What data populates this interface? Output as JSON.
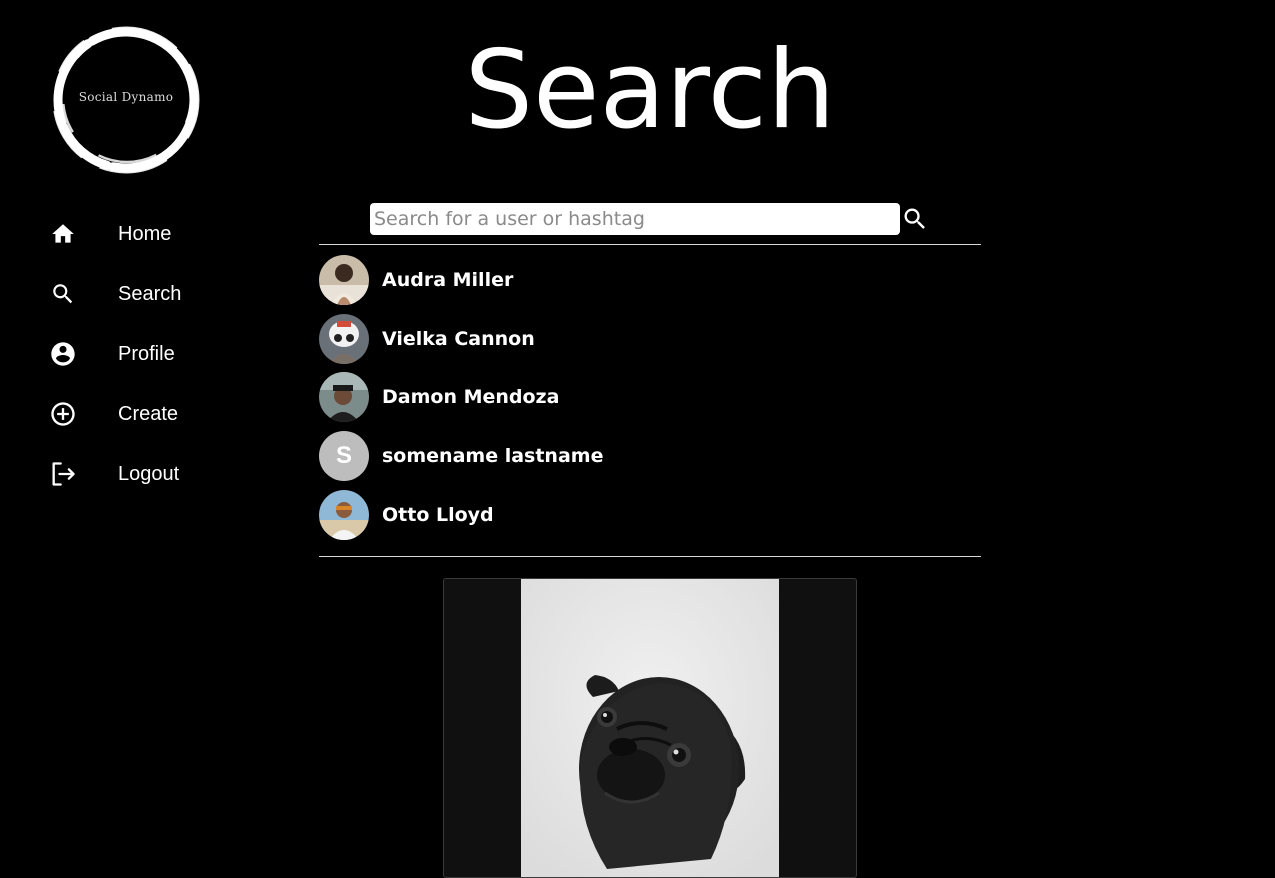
{
  "brand": {
    "logo_text": "Social Dynamo"
  },
  "sidebar": {
    "items": [
      {
        "label": "Home",
        "icon": "home-icon"
      },
      {
        "label": "Search",
        "icon": "search-icon"
      },
      {
        "label": "Profile",
        "icon": "account-circle-icon"
      },
      {
        "label": "Create",
        "icon": "add-circle-icon"
      },
      {
        "label": "Logout",
        "icon": "logout-icon"
      }
    ]
  },
  "main": {
    "title": "Search",
    "search": {
      "placeholder": "Search for a user or hashtag",
      "value": "",
      "button_icon": "search-icon"
    },
    "results": [
      {
        "name": "Audra Miller",
        "avatar": "photo"
      },
      {
        "name": "Vielka Cannon",
        "avatar": "photo"
      },
      {
        "name": "Damon Mendoza",
        "avatar": "photo"
      },
      {
        "name": "somename lastname",
        "avatar_letter": "S"
      },
      {
        "name": "Otto Lloyd",
        "avatar": "photo"
      }
    ],
    "post": {
      "image_subject": "black pug photo"
    }
  },
  "colors": {
    "background": "#000000",
    "text": "#ffffff",
    "divider": "#d8d8d8",
    "letter_avatar": "#bdbdbd",
    "card": "#101010"
  }
}
